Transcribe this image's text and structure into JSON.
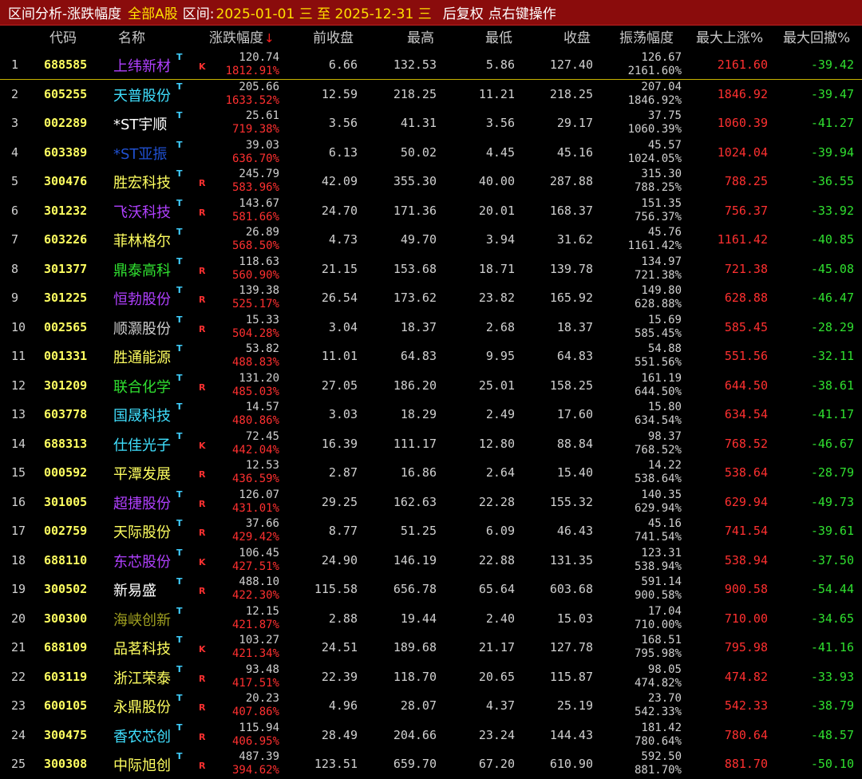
{
  "title_bar": {
    "title": "区间分析-涨跌幅度",
    "scope": "全部A股",
    "interval_label": "区间:",
    "interval_value": "2025-01-01 三 至 2025-12-31 三",
    "adjust": "后复权",
    "hint": "点右键操作"
  },
  "columns": {
    "code": "代码",
    "name": "名称",
    "change": "涨跌幅度",
    "sort_arrow": "↓",
    "prev_close": "前收盘",
    "high": "最高",
    "low": "最低",
    "close": "收盘",
    "amplitude": "振荡幅度",
    "max_up": "最大上涨%",
    "max_drawdown": "最大回撤%"
  },
  "colors": {
    "title_bg": "#8a0c0c",
    "code": "#ffff60",
    "positive": "#ff3030",
    "negative": "#30e030",
    "tag": "#40d0ff"
  },
  "rows": [
    {
      "idx": "1",
      "code": "688585",
      "name": "上纬新材",
      "name_color": "#b040ff",
      "tag": "T",
      "flag": "K",
      "chg": "120.74",
      "chg_pct": "1812.91%",
      "prev": "6.66",
      "high": "132.53",
      "low": "5.86",
      "close": "127.40",
      "amp": "126.67",
      "amp_pct": "2161.60%",
      "up": "2161.60",
      "dd": "-39.42"
    },
    {
      "idx": "2",
      "code": "605255",
      "name": "天普股份",
      "name_color": "#40e0ff",
      "tag": "T",
      "flag": "",
      "chg": "205.66",
      "chg_pct": "1633.52%",
      "prev": "12.59",
      "high": "218.25",
      "low": "11.21",
      "close": "218.25",
      "amp": "207.04",
      "amp_pct": "1846.92%",
      "up": "1846.92",
      "dd": "-39.47"
    },
    {
      "idx": "3",
      "code": "002289",
      "name": "*ST宇顺",
      "name_color": "#ffffff",
      "tag": "T",
      "flag": "",
      "chg": "25.61",
      "chg_pct": "719.38%",
      "prev": "3.56",
      "high": "41.31",
      "low": "3.56",
      "close": "29.17",
      "amp": "37.75",
      "amp_pct": "1060.39%",
      "up": "1060.39",
      "dd": "-41.27"
    },
    {
      "idx": "4",
      "code": "603389",
      "name": "*ST亚振",
      "name_color": "#2050d0",
      "tag": "T",
      "flag": "",
      "chg": "39.03",
      "chg_pct": "636.70%",
      "prev": "6.13",
      "high": "50.02",
      "low": "4.45",
      "close": "45.16",
      "amp": "45.57",
      "amp_pct": "1024.05%",
      "up": "1024.04",
      "dd": "-39.94"
    },
    {
      "idx": "5",
      "code": "300476",
      "name": "胜宏科技",
      "name_color": "#ffff60",
      "tag": "T",
      "flag": "R",
      "chg": "245.79",
      "chg_pct": "583.96%",
      "prev": "42.09",
      "high": "355.30",
      "low": "40.00",
      "close": "287.88",
      "amp": "315.30",
      "amp_pct": "788.25%",
      "up": "788.25",
      "dd": "-36.55"
    },
    {
      "idx": "6",
      "code": "301232",
      "name": "飞沃科技",
      "name_color": "#b040ff",
      "tag": "T",
      "flag": "R",
      "chg": "143.67",
      "chg_pct": "581.66%",
      "prev": "24.70",
      "high": "171.36",
      "low": "20.01",
      "close": "168.37",
      "amp": "151.35",
      "amp_pct": "756.37%",
      "up": "756.37",
      "dd": "-33.92"
    },
    {
      "idx": "7",
      "code": "603226",
      "name": "菲林格尔",
      "name_color": "#ffff60",
      "tag": "T",
      "flag": "",
      "chg": "26.89",
      "chg_pct": "568.50%",
      "prev": "4.73",
      "high": "49.70",
      "low": "3.94",
      "close": "31.62",
      "amp": "45.76",
      "amp_pct": "1161.42%",
      "up": "1161.42",
      "dd": "-40.85"
    },
    {
      "idx": "8",
      "code": "301377",
      "name": "鼎泰高科",
      "name_color": "#30e030",
      "tag": "T",
      "flag": "R",
      "chg": "118.63",
      "chg_pct": "560.90%",
      "prev": "21.15",
      "high": "153.68",
      "low": "18.71",
      "close": "139.78",
      "amp": "134.97",
      "amp_pct": "721.38%",
      "up": "721.38",
      "dd": "-45.08"
    },
    {
      "idx": "9",
      "code": "301225",
      "name": "恒勃股份",
      "name_color": "#b040ff",
      "tag": "T",
      "flag": "R",
      "chg": "139.38",
      "chg_pct": "525.17%",
      "prev": "26.54",
      "high": "173.62",
      "low": "23.82",
      "close": "165.92",
      "amp": "149.80",
      "amp_pct": "628.88%",
      "up": "628.88",
      "dd": "-46.47"
    },
    {
      "idx": "10",
      "code": "002565",
      "name": "顺灏股份",
      "name_color": "#d0d0d0",
      "tag": "T",
      "flag": "R",
      "chg": "15.33",
      "chg_pct": "504.28%",
      "prev": "3.04",
      "high": "18.37",
      "low": "2.68",
      "close": "18.37",
      "amp": "15.69",
      "amp_pct": "585.45%",
      "up": "585.45",
      "dd": "-28.29"
    },
    {
      "idx": "11",
      "code": "001331",
      "name": "胜通能源",
      "name_color": "#ffff60",
      "tag": "T",
      "flag": "",
      "chg": "53.82",
      "chg_pct": "488.83%",
      "prev": "11.01",
      "high": "64.83",
      "low": "9.95",
      "close": "64.83",
      "amp": "54.88",
      "amp_pct": "551.56%",
      "up": "551.56",
      "dd": "-32.11"
    },
    {
      "idx": "12",
      "code": "301209",
      "name": "联合化学",
      "name_color": "#30e030",
      "tag": "T",
      "flag": "R",
      "chg": "131.20",
      "chg_pct": "485.03%",
      "prev": "27.05",
      "high": "186.20",
      "low": "25.01",
      "close": "158.25",
      "amp": "161.19",
      "amp_pct": "644.50%",
      "up": "644.50",
      "dd": "-38.61"
    },
    {
      "idx": "13",
      "code": "603778",
      "name": "国晟科技",
      "name_color": "#40e0ff",
      "tag": "T",
      "flag": "",
      "chg": "14.57",
      "chg_pct": "480.86%",
      "prev": "3.03",
      "high": "18.29",
      "low": "2.49",
      "close": "17.60",
      "amp": "15.80",
      "amp_pct": "634.54%",
      "up": "634.54",
      "dd": "-41.17"
    },
    {
      "idx": "14",
      "code": "688313",
      "name": "仕佳光子",
      "name_color": "#40e0ff",
      "tag": "T",
      "flag": "K",
      "chg": "72.45",
      "chg_pct": "442.04%",
      "prev": "16.39",
      "high": "111.17",
      "low": "12.80",
      "close": "88.84",
      "amp": "98.37",
      "amp_pct": "768.52%",
      "up": "768.52",
      "dd": "-46.67"
    },
    {
      "idx": "15",
      "code": "000592",
      "name": "平潭发展",
      "name_color": "#ffff60",
      "tag": "",
      "flag": "R",
      "chg": "12.53",
      "chg_pct": "436.59%",
      "prev": "2.87",
      "high": "16.86",
      "low": "2.64",
      "close": "15.40",
      "amp": "14.22",
      "amp_pct": "538.64%",
      "up": "538.64",
      "dd": "-28.79"
    },
    {
      "idx": "16",
      "code": "301005",
      "name": "超捷股份",
      "name_color": "#b040ff",
      "tag": "T",
      "flag": "R",
      "chg": "126.07",
      "chg_pct": "431.01%",
      "prev": "29.25",
      "high": "162.63",
      "low": "22.28",
      "close": "155.32",
      "amp": "140.35",
      "amp_pct": "629.94%",
      "up": "629.94",
      "dd": "-49.73"
    },
    {
      "idx": "17",
      "code": "002759",
      "name": "天际股份",
      "name_color": "#ffff60",
      "tag": "T",
      "flag": "R",
      "chg": "37.66",
      "chg_pct": "429.42%",
      "prev": "8.77",
      "high": "51.25",
      "low": "6.09",
      "close": "46.43",
      "amp": "45.16",
      "amp_pct": "741.54%",
      "up": "741.54",
      "dd": "-39.61"
    },
    {
      "idx": "18",
      "code": "688110",
      "name": "东芯股份",
      "name_color": "#b040ff",
      "tag": "T",
      "flag": "K",
      "chg": "106.45",
      "chg_pct": "427.51%",
      "prev": "24.90",
      "high": "146.19",
      "low": "22.88",
      "close": "131.35",
      "amp": "123.31",
      "amp_pct": "538.94%",
      "up": "538.94",
      "dd": "-37.50"
    },
    {
      "idx": "19",
      "code": "300502",
      "name": "新易盛",
      "name_color": "#ffffff",
      "tag": "T",
      "flag": "R",
      "chg": "488.10",
      "chg_pct": "422.30%",
      "prev": "115.58",
      "high": "656.78",
      "low": "65.64",
      "close": "603.68",
      "amp": "591.14",
      "amp_pct": "900.58%",
      "up": "900.58",
      "dd": "-54.44"
    },
    {
      "idx": "20",
      "code": "300300",
      "name": "海峡创新",
      "name_color": "#a0a020",
      "tag": "T",
      "flag": "",
      "chg": "12.15",
      "chg_pct": "421.87%",
      "prev": "2.88",
      "high": "19.44",
      "low": "2.40",
      "close": "15.03",
      "amp": "17.04",
      "amp_pct": "710.00%",
      "up": "710.00",
      "dd": "-34.65"
    },
    {
      "idx": "21",
      "code": "688109",
      "name": "品茗科技",
      "name_color": "#ffff60",
      "tag": "T",
      "flag": "K",
      "chg": "103.27",
      "chg_pct": "421.34%",
      "prev": "24.51",
      "high": "189.68",
      "low": "21.17",
      "close": "127.78",
      "amp": "168.51",
      "amp_pct": "795.98%",
      "up": "795.98",
      "dd": "-41.16"
    },
    {
      "idx": "22",
      "code": "603119",
      "name": "浙江荣泰",
      "name_color": "#ffff60",
      "tag": "T",
      "flag": "R",
      "chg": "93.48",
      "chg_pct": "417.51%",
      "prev": "22.39",
      "high": "118.70",
      "low": "20.65",
      "close": "115.87",
      "amp": "98.05",
      "amp_pct": "474.82%",
      "up": "474.82",
      "dd": "-33.93"
    },
    {
      "idx": "23",
      "code": "600105",
      "name": "永鼎股份",
      "name_color": "#ffff60",
      "tag": "T",
      "flag": "R",
      "chg": "20.23",
      "chg_pct": "407.86%",
      "prev": "4.96",
      "high": "28.07",
      "low": "4.37",
      "close": "25.19",
      "amp": "23.70",
      "amp_pct": "542.33%",
      "up": "542.33",
      "dd": "-38.79"
    },
    {
      "idx": "24",
      "code": "300475",
      "name": "香农芯创",
      "name_color": "#40e0ff",
      "tag": "T",
      "flag": "R",
      "chg": "115.94",
      "chg_pct": "406.95%",
      "prev": "28.49",
      "high": "204.66",
      "low": "23.24",
      "close": "144.43",
      "amp": "181.42",
      "amp_pct": "780.64%",
      "up": "780.64",
      "dd": "-48.57"
    },
    {
      "idx": "25",
      "code": "300308",
      "name": "中际旭创",
      "name_color": "#ffff60",
      "tag": "T",
      "flag": "R",
      "chg": "487.39",
      "chg_pct": "394.62%",
      "prev": "123.51",
      "high": "659.70",
      "low": "67.20",
      "close": "610.90",
      "amp": "592.50",
      "amp_pct": "881.70%",
      "up": "881.70",
      "dd": "-50.10"
    }
  ]
}
